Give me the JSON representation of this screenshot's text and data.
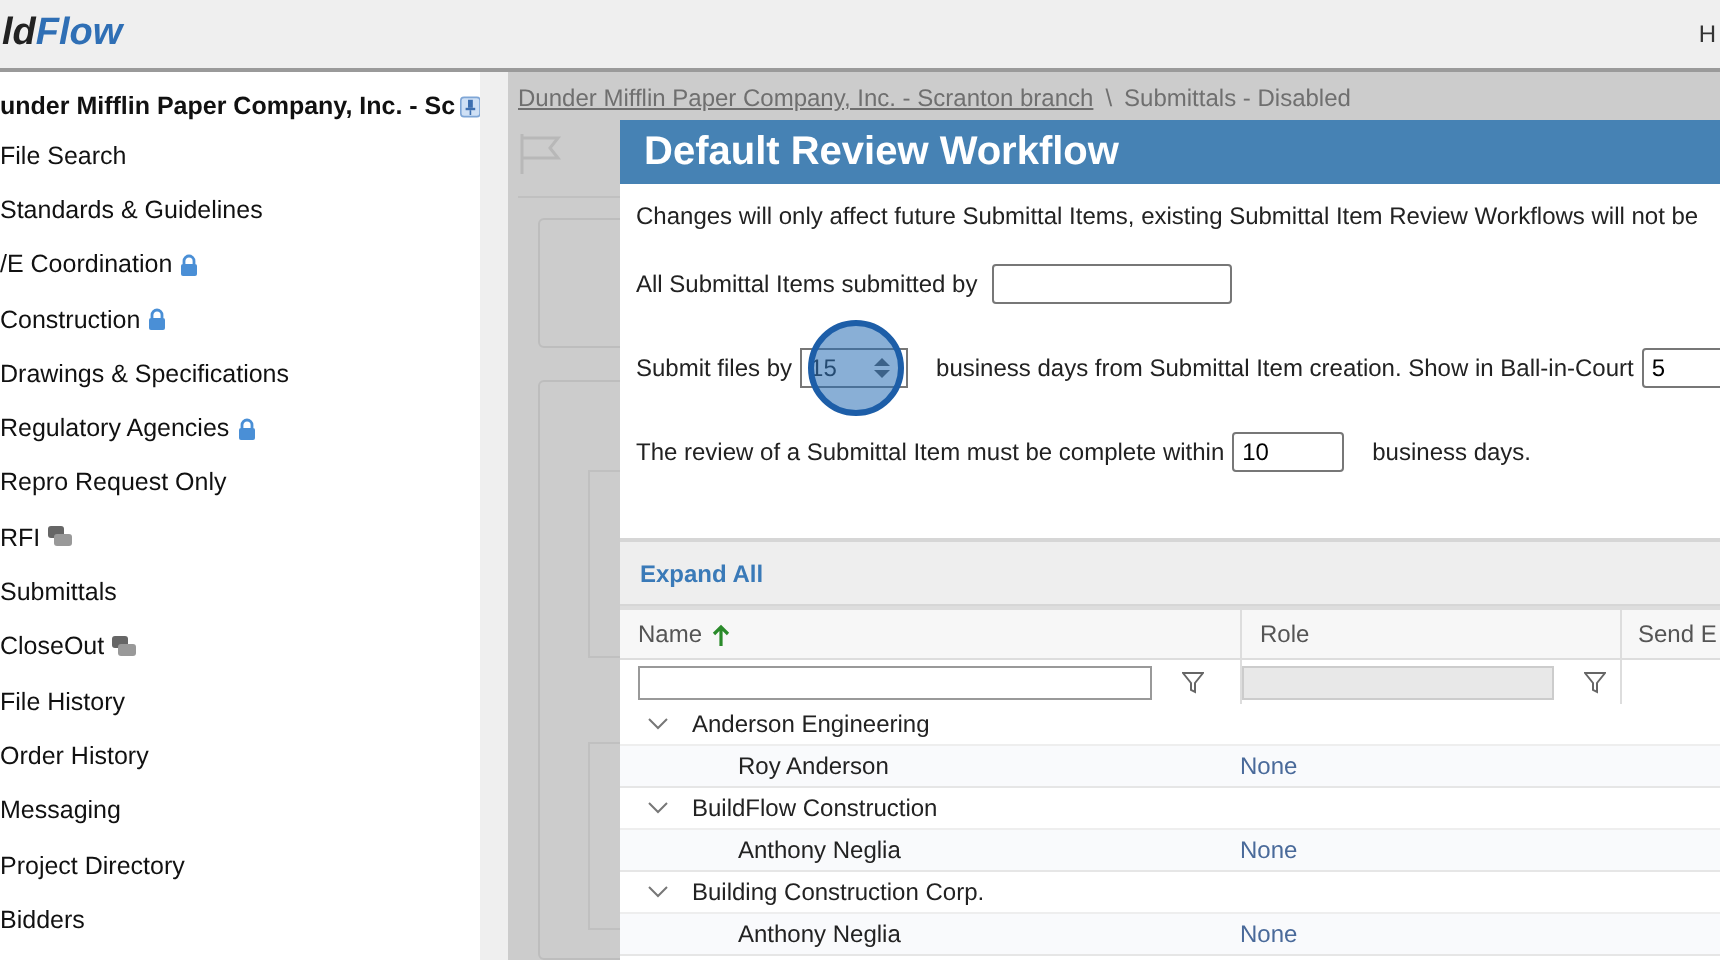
{
  "header": {
    "logo_dark": "ld",
    "logo_blue": "Flow",
    "right_text": "H"
  },
  "sidebar": {
    "title": "under Mifflin Paper Company, Inc. - Sc",
    "items": [
      {
        "label": "File Search",
        "kind": "plain"
      },
      {
        "label": "Standards & Guidelines",
        "kind": "plain"
      },
      {
        "label": "/E Coordination",
        "kind": "locked"
      },
      {
        "label": "Construction",
        "kind": "locked"
      },
      {
        "label": "Drawings & Specifications",
        "kind": "plain"
      },
      {
        "label": "Regulatory Agencies",
        "kind": "locked"
      },
      {
        "label": "Repro Request Only",
        "kind": "plain"
      },
      {
        "label": "RFI",
        "kind": "chat"
      },
      {
        "label": "Submittals",
        "kind": "plain"
      },
      {
        "label": "CloseOut",
        "kind": "chat"
      },
      {
        "label": "File History",
        "kind": "plain"
      },
      {
        "label": "Order History",
        "kind": "plain"
      },
      {
        "label": "Messaging",
        "kind": "plain"
      },
      {
        "label": "Project Directory",
        "kind": "plain"
      },
      {
        "label": "Bidders",
        "kind": "plain"
      }
    ]
  },
  "background": {
    "breadcrumb_link": "Dunder Mifflin Paper Company, Inc. - Scranton branch",
    "breadcrumb_sep": "\\",
    "breadcrumb_current": "Submittals - Disabled"
  },
  "dialog": {
    "title": "Default Review Workflow",
    "note": "Changes will only affect future Submittal Items, existing Submittal Item Review Workflows will not be",
    "submitted_by_label": "All Submittal Items submitted by",
    "submit_label": "Submit files by",
    "submit_value": "15",
    "submit_after": "business days from Submittal Item creation. Show in Ball-in-Court",
    "ball_value": "5",
    "review_label": "The review of a Submittal Item must be complete within",
    "review_value": "10",
    "review_after": "business days.",
    "expand_all": "Expand All",
    "columns": [
      "Name",
      "Role",
      "Send E"
    ],
    "groups": [
      {
        "name": "Anderson Engineering",
        "expanded": true,
        "children": [
          {
            "name": "Roy Anderson",
            "role": "None"
          }
        ]
      },
      {
        "name": "BuildFlow Construction",
        "expanded": true,
        "children": [
          {
            "name": "Anthony Neglia",
            "role": "None"
          }
        ]
      },
      {
        "name": "Building Construction Corp.",
        "expanded": true,
        "children": [
          {
            "name": "Anthony Neglia",
            "role": "None"
          }
        ]
      }
    ]
  }
}
